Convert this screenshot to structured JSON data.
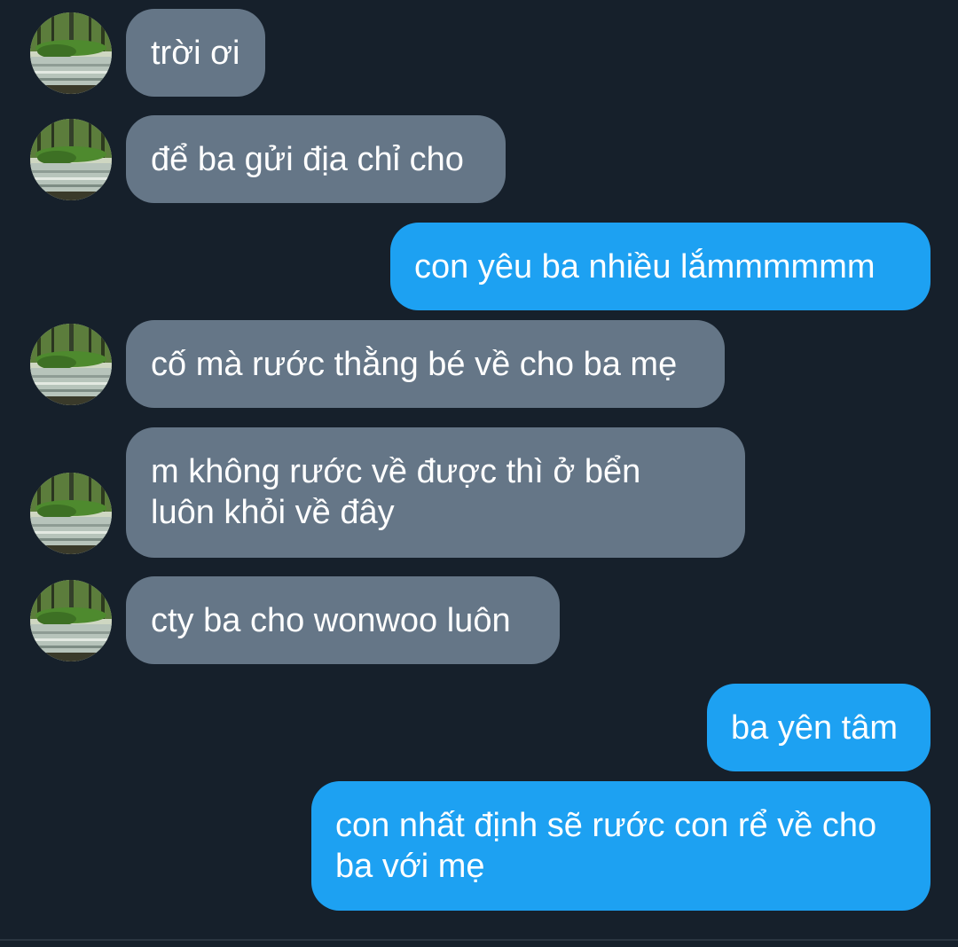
{
  "conversation": {
    "messages": [
      {
        "direction": "incoming",
        "text": "trời ơi"
      },
      {
        "direction": "incoming",
        "text": "để ba gửi địa chỉ cho"
      },
      {
        "direction": "outgoing",
        "text": "con yêu ba nhiều lắmmmmmm"
      },
      {
        "direction": "incoming",
        "text": "cố mà rước thằng bé về cho ba mẹ"
      },
      {
        "direction": "incoming",
        "text": "m không rước về được thì ở bển\nluôn khỏi về đây"
      },
      {
        "direction": "incoming",
        "text": "cty ba cho wonwoo luôn"
      },
      {
        "direction": "outgoing",
        "text": "ba yên tâm"
      },
      {
        "direction": "outgoing",
        "text": "con nhất định sẽ rước con rể về cho\nba với mẹ"
      }
    ]
  },
  "colors": {
    "background": "#16202b",
    "incoming_bubble": "#657687",
    "outgoing_bubble": "#1da1f2",
    "text": "#ffffff"
  },
  "icons": {
    "avatar": "forest-stream-avatar"
  }
}
